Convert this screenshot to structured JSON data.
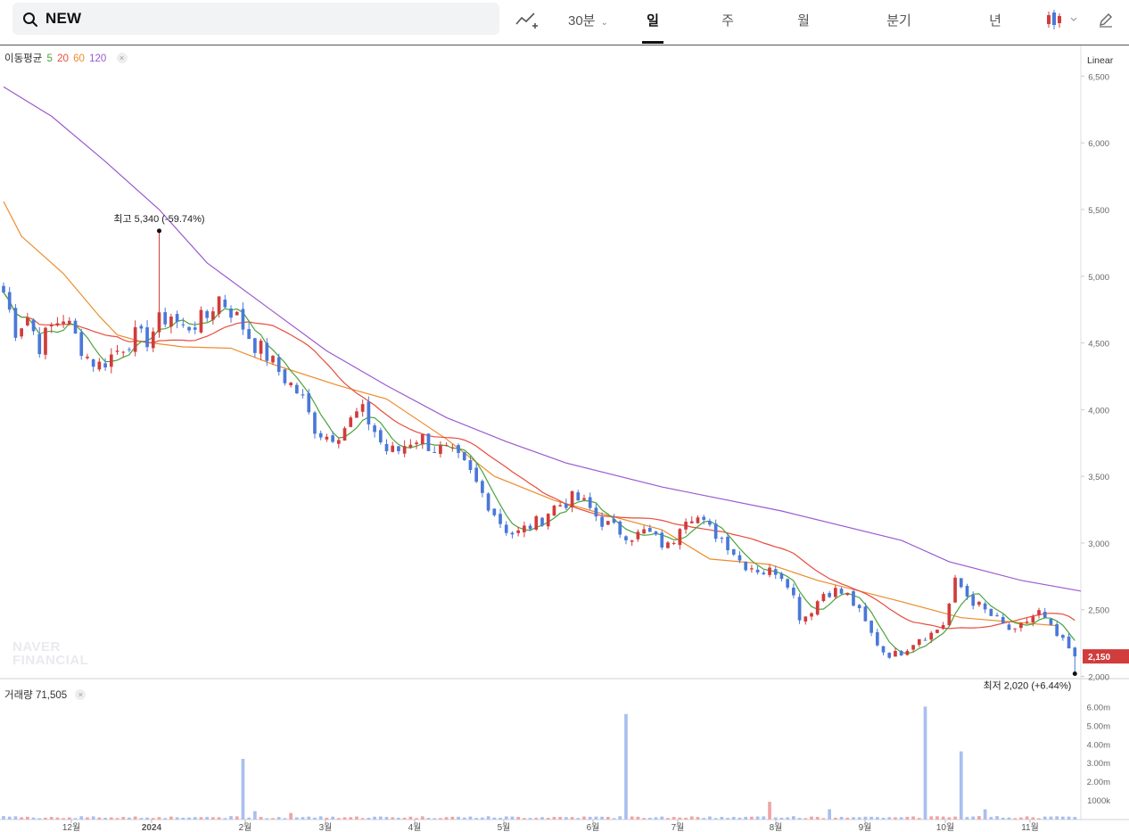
{
  "search": {
    "query": "NEW"
  },
  "toolbar": {
    "interval_label": "30분",
    "tabs": [
      {
        "label": "일",
        "active": true
      },
      {
        "label": "주",
        "active": false
      },
      {
        "label": "월",
        "active": false
      },
      {
        "label": "분기",
        "active": false
      },
      {
        "label": "년",
        "active": false
      }
    ]
  },
  "legend": {
    "ma_title": "이동평균",
    "ma_periods": [
      {
        "label": "5",
        "color": "#4aa33b"
      },
      {
        "label": "20",
        "color": "#e74c3c"
      },
      {
        "label": "60",
        "color": "#ee8c2c"
      },
      {
        "label": "120",
        "color": "#9b59d0"
      }
    ],
    "volume_title": "거래량",
    "volume_value": "71,505"
  },
  "scale_mode": "Linear",
  "watermark": {
    "line1": "NAVER",
    "line2": "FINANCIAL"
  },
  "colors": {
    "up": "#d13c3c",
    "down": "#4a78d8",
    "volume_up": "#f0a4a4",
    "volume_down": "#a9bfee"
  },
  "chart_data": {
    "type": "candlestick",
    "x_labels": [
      "12월",
      "2024",
      "2월",
      "3월",
      "4월",
      "5월",
      "6월",
      "7월",
      "8월",
      "9월",
      "10월",
      "11월"
    ],
    "y_ticks": [
      "6,500",
      "6,000",
      "5,500",
      "5,000",
      "4,500",
      "4,000",
      "3,500",
      "3,000",
      "2,500",
      "2,000"
    ],
    "y_range": [
      1990,
      6730
    ],
    "volume_ticks": [
      "6.00m",
      "5.00m",
      "4.00m",
      "3.00m",
      "2.00m",
      "1000k"
    ],
    "volume_range": [
      0,
      6400000
    ],
    "last_price": 2150,
    "last_price_label": "2,150",
    "high_annotation": {
      "label": "최고 5,340 (-59.74%)",
      "value": 5340
    },
    "low_annotation": {
      "label": "최저 2,020 (+6.44%)",
      "value": 2020
    },
    "price_path": [
      4880,
      4600,
      4700,
      4480,
      4620,
      4700,
      4550,
      4400,
      4330,
      4400,
      4480,
      4550,
      4520,
      4650,
      4720,
      4600,
      4650,
      4680,
      4850,
      4760,
      4640,
      4500,
      4420,
      4300,
      4200,
      4100,
      3880,
      3800,
      3820,
      3900,
      4000,
      3870,
      3700,
      3680,
      3760,
      3800,
      3710,
      3700,
      3640,
      3550,
      3400,
      3260,
      3120,
      3060,
      3120,
      3160,
      3260,
      3300,
      3340,
      3280,
      3180,
      3120,
      3080,
      3050,
      3090,
      3010,
      2960,
      3200,
      3220,
      3120,
      3060,
      2980,
      2850,
      2820,
      2780,
      2800,
      2700,
      2420,
      2520,
      2640,
      2640,
      2600,
      2460,
      2300,
      2180,
      2160,
      2230,
      2300,
      2320,
      2400,
      2720,
      2600,
      2520,
      2450,
      2380,
      2320,
      2420,
      2480,
      2350,
      2250,
      2150
    ],
    "volume_spikes": {
      "20": 3200000,
      "52": 5600000,
      "77": 6000000,
      "80": 3600000,
      "21": 400000,
      "24": 300000,
      "64": 900000,
      "69": 500000,
      "82": 500000
    },
    "ma": {
      "120": [
        [
          0,
          6420
        ],
        [
          8,
          6200
        ],
        [
          17,
          5860
        ],
        [
          26,
          5500
        ],
        [
          34,
          5100
        ],
        [
          44,
          4770
        ],
        [
          54,
          4440
        ],
        [
          64,
          4180
        ],
        [
          74,
          3940
        ],
        [
          84,
          3760
        ],
        [
          94,
          3600
        ],
        [
          110,
          3420
        ],
        [
          130,
          3240
        ],
        [
          150,
          3020
        ],
        [
          158,
          2860
        ],
        [
          170,
          2720
        ],
        [
          180,
          2640
        ]
      ],
      "60": [
        [
          0,
          5560
        ],
        [
          3,
          5300
        ],
        [
          10,
          5020
        ],
        [
          16,
          4700
        ],
        [
          19,
          4560
        ],
        [
          23,
          4510
        ],
        [
          30,
          4470
        ],
        [
          38,
          4460
        ],
        [
          45,
          4340
        ],
        [
          56,
          4180
        ],
        [
          64,
          4080
        ],
        [
          74,
          3780
        ],
        [
          82,
          3500
        ],
        [
          92,
          3320
        ],
        [
          100,
          3220
        ],
        [
          110,
          3100
        ],
        [
          118,
          2880
        ],
        [
          128,
          2840
        ],
        [
          136,
          2720
        ],
        [
          150,
          2560
        ],
        [
          160,
          2440
        ],
        [
          176,
          2380
        ]
      ]
    }
  }
}
